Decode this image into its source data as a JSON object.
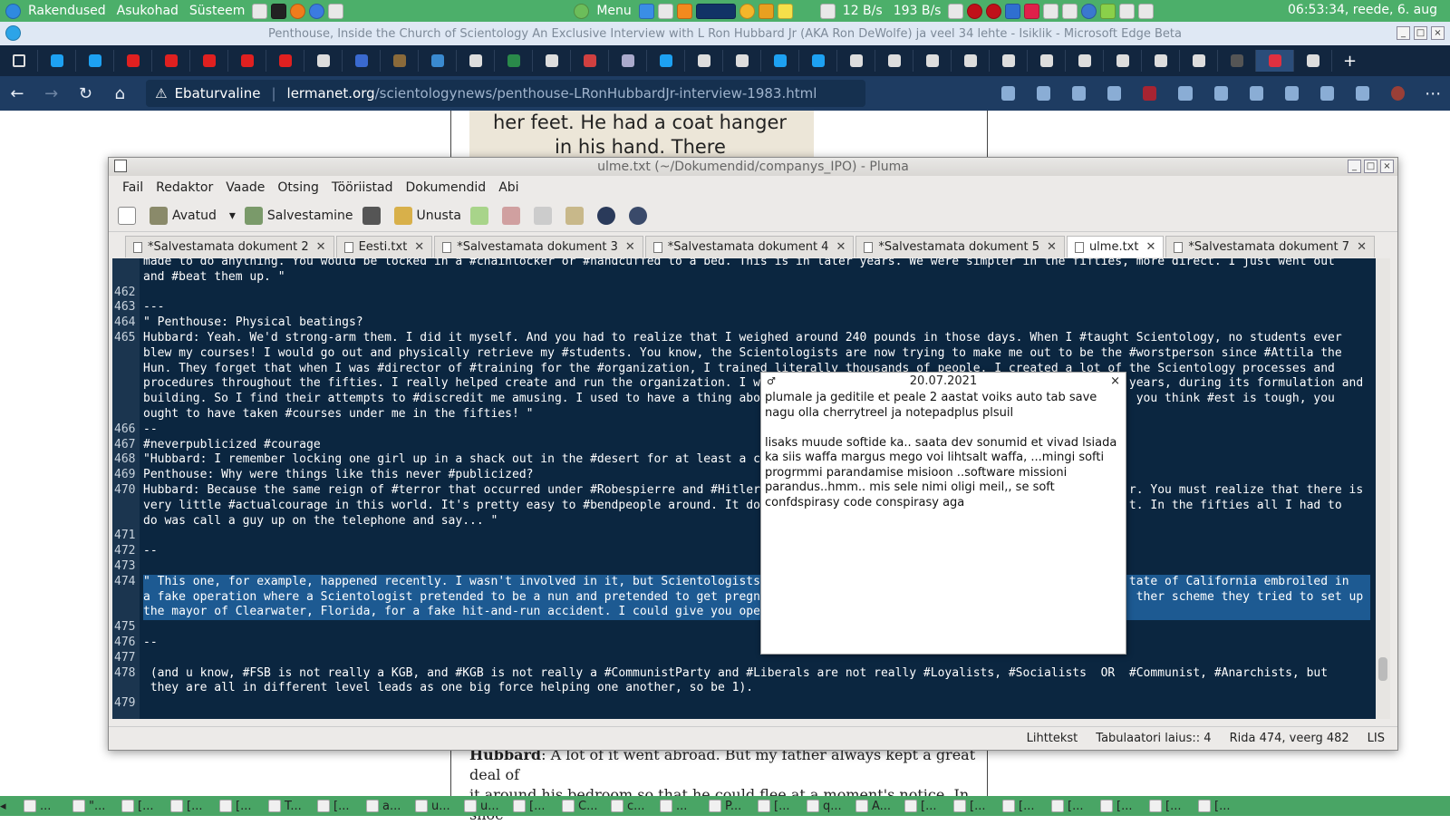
{
  "panel": {
    "menus": [
      "Rakendused",
      "Asukohad",
      "Süsteem"
    ],
    "menu_btn": "Menu",
    "net_down": "12 B/s",
    "net_up": "193 B/s",
    "clock": "06:53:34, reede, 6. aug"
  },
  "browser": {
    "window_title": "Penthouse, Inside the Church of Scientology An Exclusive Interview with L Ron Hubbard Jr (AKA Ron DeWolfe) ja veel 34 lehte - Isiklik - Microsoft Edge Beta",
    "security_label": "Ebaturvaline",
    "url_host": "lermanet.org",
    "url_path": "/scientologynews/penthouse-LRonHubbardJr-interview-1983.html",
    "tab_count_visible": 34
  },
  "webpage": {
    "scan_line1": "her feet. He had a coat hanger",
    "scan_line2": "in his hand. There",
    "bottom_speaker": "Hubbard",
    "bottom_text": ": A lot of it went abroad. But my father always kept a great deal of",
    "bottom_text2": "it around his bedroom so that he could flee at a moment's notice. In shoe"
  },
  "pluma": {
    "title": "ulme.txt (~/Dokumendid/companys_IPO) - Pluma",
    "menu": [
      "Fail",
      "Redaktor",
      "Vaade",
      "Otsing",
      "Tööriistad",
      "Dokumendid",
      "Abi"
    ],
    "toolbar": {
      "open": "Avatud",
      "save": "Salvestamine",
      "undo": "Unusta"
    },
    "tabs": [
      "*Salvestamata dokument 2",
      "Eesti.txt",
      "*Salvestamata dokument 3",
      "*Salvestamata dokument 4",
      "*Salvestamata dokument 5",
      "ulme.txt",
      "*Salvestamata dokument 7"
    ],
    "status": {
      "lang": "Lihttekst",
      "tab_width": "Tabulaatori laius::  4",
      "position": "Rida 474, veerg 482",
      "mode": "LIS"
    },
    "lines": [
      {
        "n": "",
        "t": "made to do anything. You would be locked in a #chainlocker or #handcuffed to a bed. This is in later years. We were simpler in the fifties, more direct. I just went out"
      },
      {
        "n": "",
        "t": "and #beat them up. \""
      },
      {
        "n": "462",
        "t": ""
      },
      {
        "n": "463",
        "t": "---"
      },
      {
        "n": "464",
        "t": "\" Penthouse: Physical beatings?"
      },
      {
        "n": "465",
        "t": "Hubbard: Yeah. We'd strong-arm them. I did it myself. And you had to realize that I weighed around 240 pounds in those days. When I #taught Scientology, no students ever"
      },
      {
        "n": "",
        "t": "blew my courses! I would go out and physically retrieve my #students. You know, the Scientologists are now trying to make me out to be the #worstperson since #Attila the"
      },
      {
        "n": "",
        "t": "Hun. They forget that when I was #director of #training for the #organization, I trained literally thousands of people. I created a lot of the Scientology processes and"
      },
      {
        "n": "",
        "t": "procedures throughout the fifties. I really helped create and run the organization. I was                                                  years, during its formulation and"
      },
      {
        "n": "",
        "t": "building. So I find their attempts to #discredit me amusing. I used to have a thing abou                                                    you think #est is tough, you"
      },
      {
        "n": "",
        "t": "ought to have taken #courses under me in the fifties! \""
      },
      {
        "n": "466",
        "t": "--"
      },
      {
        "n": "467",
        "t": "#neverpublicized #courage"
      },
      {
        "n": "468",
        "t": "\"Hubbard: I remember locking one girl up in a shack out in the #desert for at least a co"
      },
      {
        "n": "469",
        "t": "Penthouse: Why were things like this never #publicized?"
      },
      {
        "n": "470",
        "t": "Hubbard: Because the same reign of #terror that occurred under #Robespierre and #Hitler                                                    r. You must realize that there is"
      },
      {
        "n": "",
        "t": "very little #actualcourage in this world. It's pretty easy to #bendpeople around. It do                                                    t. In the fifties all I had to"
      },
      {
        "n": "",
        "t": "do was call a guy up on the telephone and say... \""
      },
      {
        "n": "471",
        "t": ""
      },
      {
        "n": "472",
        "t": "--"
      },
      {
        "n": "473",
        "t": ""
      },
      {
        "n": "474",
        "t": "\" This one, for example, happened recently. I wasn't involved in it, but Scientologists                                                    tate of California embroiled in",
        "hl": true
      },
      {
        "n": "",
        "t": "a fake operation where a Scientologist pretended to be a nun and pretended to get pregna                                                    ther scheme they tried to set up",
        "hl": true
      },
      {
        "n": "",
        "t": "the mayor of Clearwater, Florida, for a fake hit-and-run accident. I could give you ope                                                             ",
        "hl": true
      },
      {
        "n": "475",
        "t": ""
      },
      {
        "n": "476",
        "t": "--"
      },
      {
        "n": "477",
        "t": ""
      },
      {
        "n": "478",
        "t": " (and u know, #FSB is not really a KGB, and #KGB is not really a #CommunistParty and #Liberals are not really #Loyalists, #Socialists  OR  #Communist, #Anarchists, but"
      },
      {
        "n": "",
        "t": " they are all in different level leads as one big force helping one another, so be 1)."
      },
      {
        "n": "479",
        "t": ""
      }
    ]
  },
  "note": {
    "date": "20.07.2021",
    "line1": "plumale ja geditile et peale 2 aastat voiks auto tab save",
    "line2": "nagu olla cherrytreel ja notepadplus plsuil",
    "line3": "",
    "line4": "lisaks muude softide ka.. saata dev sonumid et vivad lsiada",
    "line5": "ka siis waffa margus mego voi lihtsalt waffa, ...mingi softi",
    "line6": "progrmmi parandamise misioon ..software missioni",
    "line7": "parandus..hmm.. mis sele nimi oligi meil,, se soft",
    "line8": "confdspirasy code conspirasy aga"
  },
  "taskbar": {
    "items": [
      "...",
      "\"...",
      "[...",
      "[...",
      "[...",
      "T...",
      "[...",
      "a...",
      "u...",
      "u...",
      "[...",
      "C...",
      "c...",
      "...",
      "P...",
      "[...",
      "q...",
      "A...",
      "[...",
      "[...",
      "[...",
      "[...",
      "[...",
      "[...",
      "[..."
    ]
  },
  "colors": {
    "panel": "#4caf6a",
    "edge_tabs": "#12263f",
    "edge_addr": "#1e3c62",
    "editor_bg": "#0b2640",
    "selection": "#1d5a92"
  }
}
